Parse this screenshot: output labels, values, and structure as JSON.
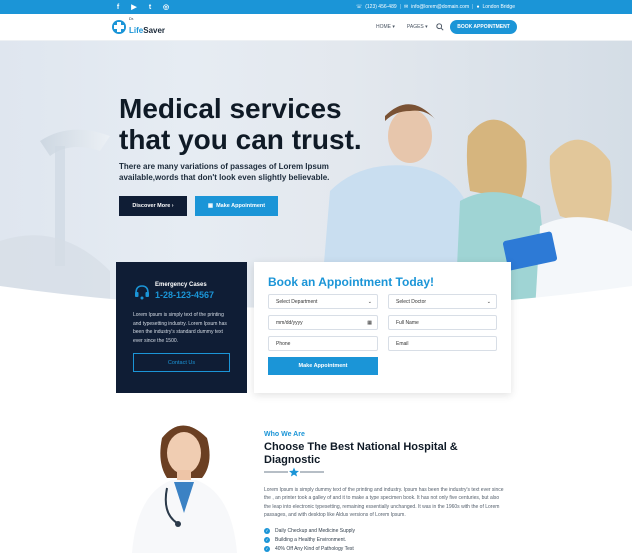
{
  "topbar": {
    "social": [
      {
        "icon": "facebook-icon",
        "glyph": "f"
      },
      {
        "icon": "youtube-icon",
        "glyph": "▶"
      },
      {
        "icon": "twitter-icon",
        "glyph": "t"
      },
      {
        "icon": "instagram-icon",
        "glyph": "◎"
      }
    ],
    "phone": "(123) 456-489",
    "email": "info@lorem@domain.com",
    "location": "London Bridge"
  },
  "header": {
    "logo_prefix": "Dr.",
    "logo_name_a": "Life",
    "logo_name_b": "Saver",
    "nav": [
      "HOME",
      "PAGES"
    ],
    "book_button": "BOOK APPOINTMENT"
  },
  "hero": {
    "headline": "Medical services that you can trust.",
    "subtext": "There are many variations of passages of Lorem Ipsum available,words that don't look even slightly believable.",
    "discover_button": "Discover More",
    "make_button": "Make Appointment"
  },
  "emergency": {
    "title": "Emergency Cases",
    "phone": "1-28-123-4567",
    "text": "Lorem Ipsum is simply text of the printing and typesetting industry. Lorem Ipsum has been the industry's standard dummy text ever since the 1500.",
    "contact_button": "Contact Us"
  },
  "appointment": {
    "title": "Book an Appointment Today!",
    "department": "Select Department",
    "doctor": "Select Doctor",
    "date_placeholder": "mm/dd/yyyy",
    "name_placeholder": "Full Name",
    "phone_placeholder": "Phone",
    "email_placeholder": "Email",
    "submit": "Make Appointment"
  },
  "about": {
    "eyebrow": "Who We Are",
    "title": "Choose The Best National Hospital & Diagnostic",
    "text": "Lorem Ipsum is simply dummy text of the printing and industry. Ipsum has been the industry's text ever since the , an printer took a galley of and it to make a type specimen book. It has not only five centuries, but also the leap into electronic typesetting, remaining essentially unchanged. It was in the 1960s with the of Lorem passages, and with desktop like Aldus versions of Lorem Ipsum.",
    "checks": [
      "Daily Checkup and Medicine Supply",
      "Building a Healthy Environment.",
      "40% Off Any Kind of Pathology Test"
    ]
  },
  "colors": {
    "brand": "#1b95d7",
    "navy": "#0f1d35"
  }
}
